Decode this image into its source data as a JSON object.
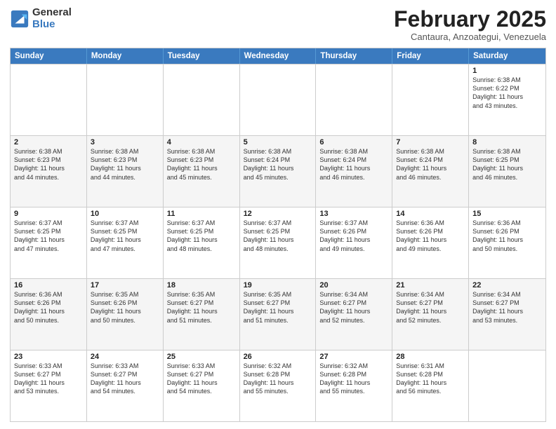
{
  "header": {
    "logo_general": "General",
    "logo_blue": "Blue",
    "month_title": "February 2025",
    "location": "Cantaura, Anzoategui, Venezuela"
  },
  "days_of_week": [
    "Sunday",
    "Monday",
    "Tuesday",
    "Wednesday",
    "Thursday",
    "Friday",
    "Saturday"
  ],
  "weeks": [
    {
      "alt": false,
      "days": [
        {
          "num": "",
          "info": ""
        },
        {
          "num": "",
          "info": ""
        },
        {
          "num": "",
          "info": ""
        },
        {
          "num": "",
          "info": ""
        },
        {
          "num": "",
          "info": ""
        },
        {
          "num": "",
          "info": ""
        },
        {
          "num": "1",
          "info": "Sunrise: 6:38 AM\nSunset: 6:22 PM\nDaylight: 11 hours\nand 43 minutes."
        }
      ]
    },
    {
      "alt": true,
      "days": [
        {
          "num": "2",
          "info": "Sunrise: 6:38 AM\nSunset: 6:23 PM\nDaylight: 11 hours\nand 44 minutes."
        },
        {
          "num": "3",
          "info": "Sunrise: 6:38 AM\nSunset: 6:23 PM\nDaylight: 11 hours\nand 44 minutes."
        },
        {
          "num": "4",
          "info": "Sunrise: 6:38 AM\nSunset: 6:23 PM\nDaylight: 11 hours\nand 45 minutes."
        },
        {
          "num": "5",
          "info": "Sunrise: 6:38 AM\nSunset: 6:24 PM\nDaylight: 11 hours\nand 45 minutes."
        },
        {
          "num": "6",
          "info": "Sunrise: 6:38 AM\nSunset: 6:24 PM\nDaylight: 11 hours\nand 46 minutes."
        },
        {
          "num": "7",
          "info": "Sunrise: 6:38 AM\nSunset: 6:24 PM\nDaylight: 11 hours\nand 46 minutes."
        },
        {
          "num": "8",
          "info": "Sunrise: 6:38 AM\nSunset: 6:25 PM\nDaylight: 11 hours\nand 46 minutes."
        }
      ]
    },
    {
      "alt": false,
      "days": [
        {
          "num": "9",
          "info": "Sunrise: 6:37 AM\nSunset: 6:25 PM\nDaylight: 11 hours\nand 47 minutes."
        },
        {
          "num": "10",
          "info": "Sunrise: 6:37 AM\nSunset: 6:25 PM\nDaylight: 11 hours\nand 47 minutes."
        },
        {
          "num": "11",
          "info": "Sunrise: 6:37 AM\nSunset: 6:25 PM\nDaylight: 11 hours\nand 48 minutes."
        },
        {
          "num": "12",
          "info": "Sunrise: 6:37 AM\nSunset: 6:25 PM\nDaylight: 11 hours\nand 48 minutes."
        },
        {
          "num": "13",
          "info": "Sunrise: 6:37 AM\nSunset: 6:26 PM\nDaylight: 11 hours\nand 49 minutes."
        },
        {
          "num": "14",
          "info": "Sunrise: 6:36 AM\nSunset: 6:26 PM\nDaylight: 11 hours\nand 49 minutes."
        },
        {
          "num": "15",
          "info": "Sunrise: 6:36 AM\nSunset: 6:26 PM\nDaylight: 11 hours\nand 50 minutes."
        }
      ]
    },
    {
      "alt": true,
      "days": [
        {
          "num": "16",
          "info": "Sunrise: 6:36 AM\nSunset: 6:26 PM\nDaylight: 11 hours\nand 50 minutes."
        },
        {
          "num": "17",
          "info": "Sunrise: 6:35 AM\nSunset: 6:26 PM\nDaylight: 11 hours\nand 50 minutes."
        },
        {
          "num": "18",
          "info": "Sunrise: 6:35 AM\nSunset: 6:27 PM\nDaylight: 11 hours\nand 51 minutes."
        },
        {
          "num": "19",
          "info": "Sunrise: 6:35 AM\nSunset: 6:27 PM\nDaylight: 11 hours\nand 51 minutes."
        },
        {
          "num": "20",
          "info": "Sunrise: 6:34 AM\nSunset: 6:27 PM\nDaylight: 11 hours\nand 52 minutes."
        },
        {
          "num": "21",
          "info": "Sunrise: 6:34 AM\nSunset: 6:27 PM\nDaylight: 11 hours\nand 52 minutes."
        },
        {
          "num": "22",
          "info": "Sunrise: 6:34 AM\nSunset: 6:27 PM\nDaylight: 11 hours\nand 53 minutes."
        }
      ]
    },
    {
      "alt": false,
      "days": [
        {
          "num": "23",
          "info": "Sunrise: 6:33 AM\nSunset: 6:27 PM\nDaylight: 11 hours\nand 53 minutes."
        },
        {
          "num": "24",
          "info": "Sunrise: 6:33 AM\nSunset: 6:27 PM\nDaylight: 11 hours\nand 54 minutes."
        },
        {
          "num": "25",
          "info": "Sunrise: 6:33 AM\nSunset: 6:27 PM\nDaylight: 11 hours\nand 54 minutes."
        },
        {
          "num": "26",
          "info": "Sunrise: 6:32 AM\nSunset: 6:28 PM\nDaylight: 11 hours\nand 55 minutes."
        },
        {
          "num": "27",
          "info": "Sunrise: 6:32 AM\nSunset: 6:28 PM\nDaylight: 11 hours\nand 55 minutes."
        },
        {
          "num": "28",
          "info": "Sunrise: 6:31 AM\nSunset: 6:28 PM\nDaylight: 11 hours\nand 56 minutes."
        },
        {
          "num": "",
          "info": ""
        }
      ]
    }
  ]
}
